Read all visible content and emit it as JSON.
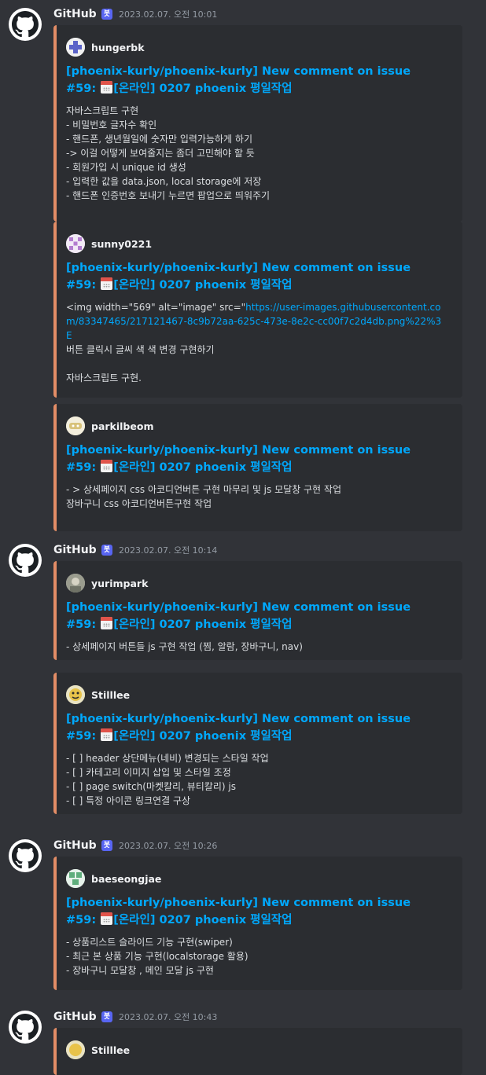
{
  "messages": [
    {
      "author": "GitHub",
      "badge": "봇",
      "timestamp": "2023.02.07. 오전 10:01",
      "embeds": [
        {
          "author": "hungerbk",
          "title_pre": "[phoenix-kurly/phoenix-kurly] New comment on issue #59: ",
          "title_post": "[온라인] 0207 phoenix 평일작업",
          "lines": [
            "자바스크립트 구현",
            "- 비밀번호 글자수 확인",
            "- 핸드폰, 생년월일에 숫자만 입력가능하게 하기",
            "-> 이걸 어떻게 보여줄지는 좀더 고민해야 할 듯",
            "- 회원가입 시 unique id 생성",
            "- 입력한 값을 data.json, local storage에 저장",
            "- 핸드폰 인증번호 보내기 누르면 팝업으로 띄워주기"
          ]
        },
        {
          "author": "sunny0221",
          "title_pre": "[phoenix-kurly/phoenix-kurly] New comment on issue #59: ",
          "title_post": "[온라인] 0207 phoenix 평일작업",
          "img_prefix": "<img width=\"569\" alt=\"image\" src=\"",
          "img_link": "https://user-images.githubusercontent.com/83347465/217121467-8c9b72aa-625c-473e-8e2c-cc00f7c2d4db.png%22%3E",
          "lines": [
            "버튼 클릭시 글씨 색 색 변경 구현하기",
            "",
            "자바스크립트 구현."
          ]
        },
        {
          "author": "parkilbeom",
          "title_pre": "[phoenix-kurly/phoenix-kurly] New comment on issue #59: ",
          "title_post": "[온라인] 0207 phoenix 평일작업",
          "lines": [
            "- > 상세페이지 css 아코디언버튼 구현 마무리 및 js 모달창 구현 작업",
            "장바구니 css 아코디언버튼구현 작업"
          ]
        }
      ]
    },
    {
      "author": "GitHub",
      "badge": "봇",
      "timestamp": "2023.02.07. 오전 10:14",
      "embeds": [
        {
          "author": "yurimpark",
          "title_pre": "[phoenix-kurly/phoenix-kurly] New comment on issue #59: ",
          "title_post": "[온라인] 0207 phoenix 평일작업",
          "lines": [
            "- 상세페이지 버튼들 js 구현 작업 (찜, 알람, 장바구니, nav)"
          ]
        },
        {
          "author": "Stilllee",
          "title_pre": "[phoenix-kurly/phoenix-kurly] New comment on issue #59: ",
          "title_post": "[온라인] 0207 phoenix 평일작업",
          "lines": [
            "- [ ] header 상단메뉴(네비) 변경되는 스타일 작업",
            "- [ ] 카테고리 이미지 삽입 및 스타일 조정",
            "- [ ] page switch(마켓칼리, 뷰티칼리) js",
            "- [ ] 특정 아이콘 링크연결 구상"
          ]
        }
      ]
    },
    {
      "author": "GitHub",
      "badge": "봇",
      "timestamp": "2023.02.07. 오전 10:26",
      "embeds": [
        {
          "author": "baeseongjae",
          "title_pre": "[phoenix-kurly/phoenix-kurly] New comment on issue #59: ",
          "title_post": "[온라인] 0207 phoenix 평일작업",
          "lines": [
            "- 상품리스트 슬라이드 기능 구현(swiper)",
            "- 최근 본 상품 기능 구현(localstorage 활용)",
            "- 장바구니 모달창 , 메인 모달 js 구현"
          ]
        }
      ]
    },
    {
      "author": "GitHub",
      "badge": "봇",
      "timestamp": "2023.02.07. 오전 10:43",
      "embeds": [
        {
          "author": "Stilllee"
        }
      ]
    }
  ]
}
